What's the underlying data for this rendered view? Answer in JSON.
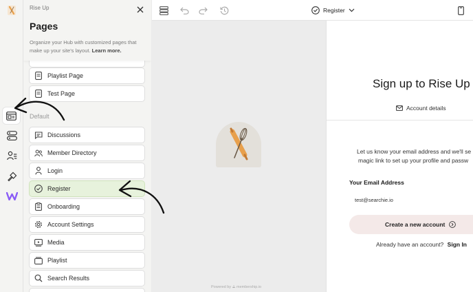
{
  "sidebar_rail": {
    "icons": [
      "brand-logo-icon",
      "pages-icon",
      "sections-icon",
      "members-icon",
      "design-icon",
      "logo-w-icon"
    ]
  },
  "panel": {
    "breadcrumb": "Rise Up",
    "title": "Pages",
    "description": "Organize your Hub with customized pages that make up your site's layout.",
    "learn_more": "Learn more.",
    "custom_pages": [
      {
        "label": "Playlist Page",
        "icon": "page-icon"
      },
      {
        "label": "Test Page",
        "icon": "page-icon"
      }
    ],
    "default_section_label": "Default",
    "default_pages": [
      {
        "label": "Discussions",
        "icon": "chat-icon"
      },
      {
        "label": "Member Directory",
        "icon": "people-icon"
      },
      {
        "label": "Login",
        "icon": "login-icon"
      },
      {
        "label": "Register",
        "icon": "check-circle-icon",
        "selected": true
      },
      {
        "label": "Onboarding",
        "icon": "clipboard-icon"
      },
      {
        "label": "Account Settings",
        "icon": "gear-icon"
      },
      {
        "label": "Media",
        "icon": "media-icon"
      },
      {
        "label": "Playlist",
        "icon": "playlist-icon"
      },
      {
        "label": "Search Results",
        "icon": "search-icon"
      }
    ]
  },
  "toolbar": {
    "current_page": "Register"
  },
  "canvas": {
    "powered_by": "Powered by",
    "brand": "membership.io"
  },
  "preview": {
    "heading": "Sign up to Rise Up",
    "tab_label": "Account details",
    "info_line1": "Let us know your email address and we'll se",
    "info_line2": "magic link to set up your profile and passw",
    "email_label": "Your Email Address",
    "email_value": "test@searchie.io",
    "create_button": "Create a new account",
    "already_text": "Already have an account?",
    "sign_in": "Sign In"
  },
  "colors": {
    "selected_item_bg": "#e7f2dc",
    "create_button_bg": "#f4e9e8",
    "brand_orange": "#e8a04c",
    "logo_purple": "#8a5cf6"
  }
}
